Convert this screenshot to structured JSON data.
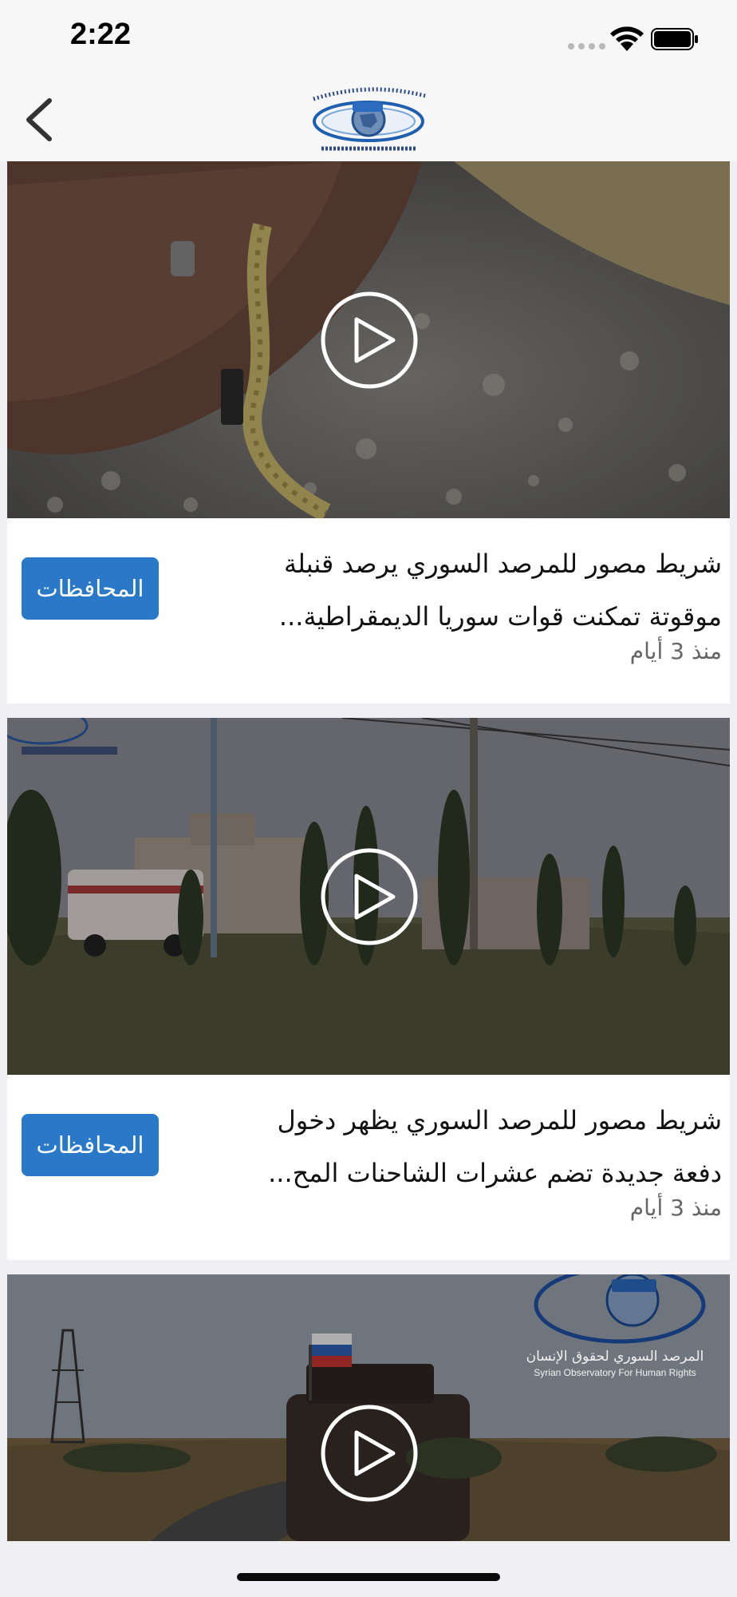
{
  "status_bar": {
    "time": "2:22"
  },
  "nav": {
    "logo_alt": "SOHR"
  },
  "feed": {
    "items": [
      {
        "title_line1": "شريط مصور للمرصد السوري يرصد قنبلة",
        "title_line2": "موقوتة تمكنت قوات سوريا الديمقراطية...",
        "date": "منذ 3 أيام",
        "tag": "المحافظات"
      },
      {
        "title_line1": "شريط مصور للمرصد السوري يظهر دخول",
        "title_line2": "دفعة جديدة تضم عشرات الشاحنات المح...",
        "date": "منذ 3 أيام",
        "tag": "المحافظات"
      },
      {
        "watermark_line1": "المرصد السوري لحقوق الإنسان",
        "watermark_line2": "Syrian Observatory For Human Rights"
      }
    ]
  },
  "colors": {
    "accent": "#2a78c8",
    "background": "#efeff4",
    "bar": "#f7f7f7"
  }
}
